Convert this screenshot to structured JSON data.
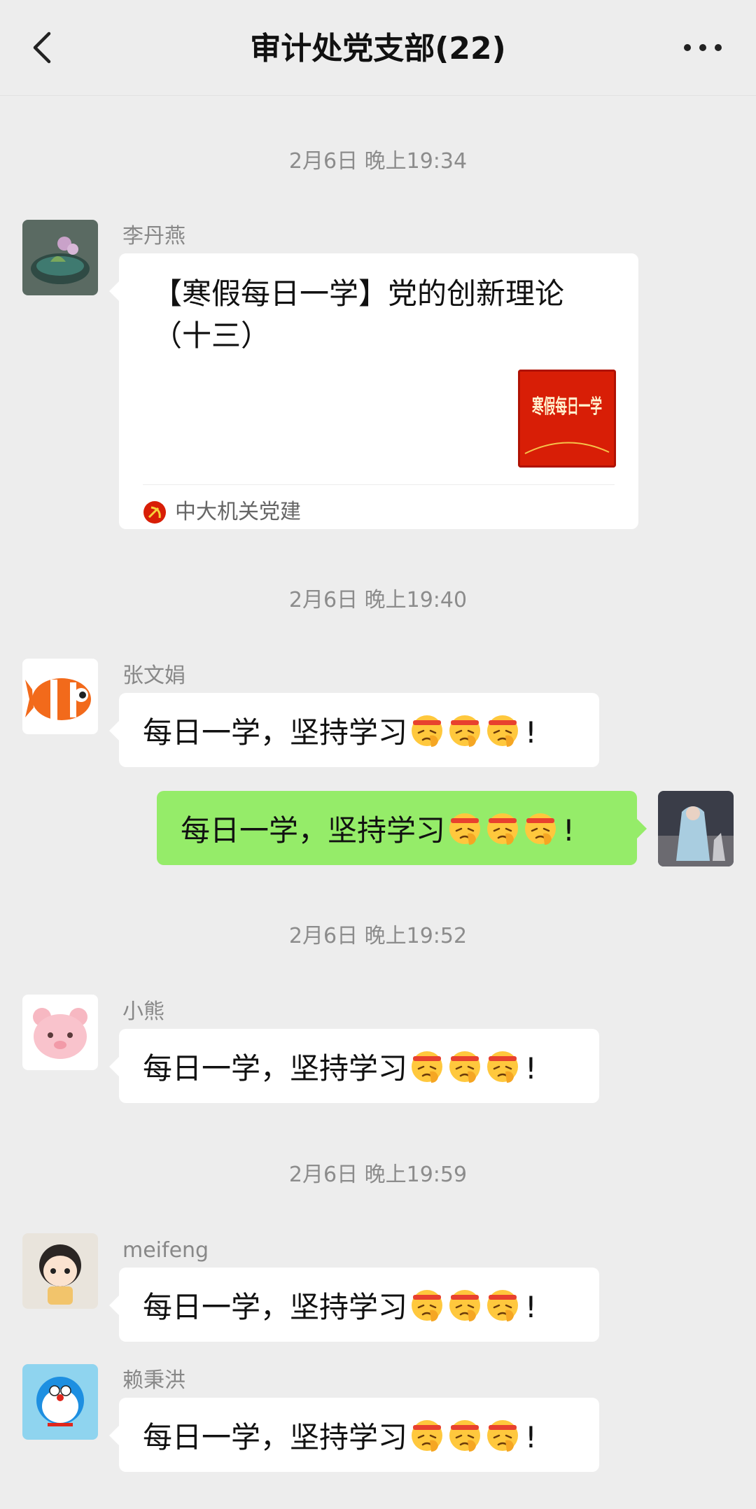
{
  "header": {
    "title": "审计处党支部(22)"
  },
  "messages": [
    {
      "time": "2月6日 晚上19:34",
      "sender": "李丹燕",
      "card": {
        "title": "【寒假每日一学】党的创新理论（十三）",
        "thumb_text": "寒假每日一学",
        "source": "中大机关党建"
      }
    },
    {
      "time": "2月6日 晚上19:40",
      "sender": "张文娟",
      "text": "每日一学，坚持学习"
    },
    {
      "sender": "me",
      "text": "每日一学，坚持学习"
    },
    {
      "time": "2月6日 晚上19:52",
      "sender": "小熊",
      "text": "每日一学，坚持学习"
    },
    {
      "time": "2月6日 晚上19:59",
      "sender": "meifeng",
      "text": "每日一学，坚持学习"
    },
    {
      "sender": "赖秉洪",
      "text": "每日一学，坚持学习"
    }
  ],
  "exclamation": "!",
  "emoji_icon": "salute-emoji-icon",
  "colors": {
    "background": "#ededed",
    "bubble_self": "#95ec69",
    "bubble_other": "#ffffff",
    "thumb_red": "#d81e06"
  }
}
